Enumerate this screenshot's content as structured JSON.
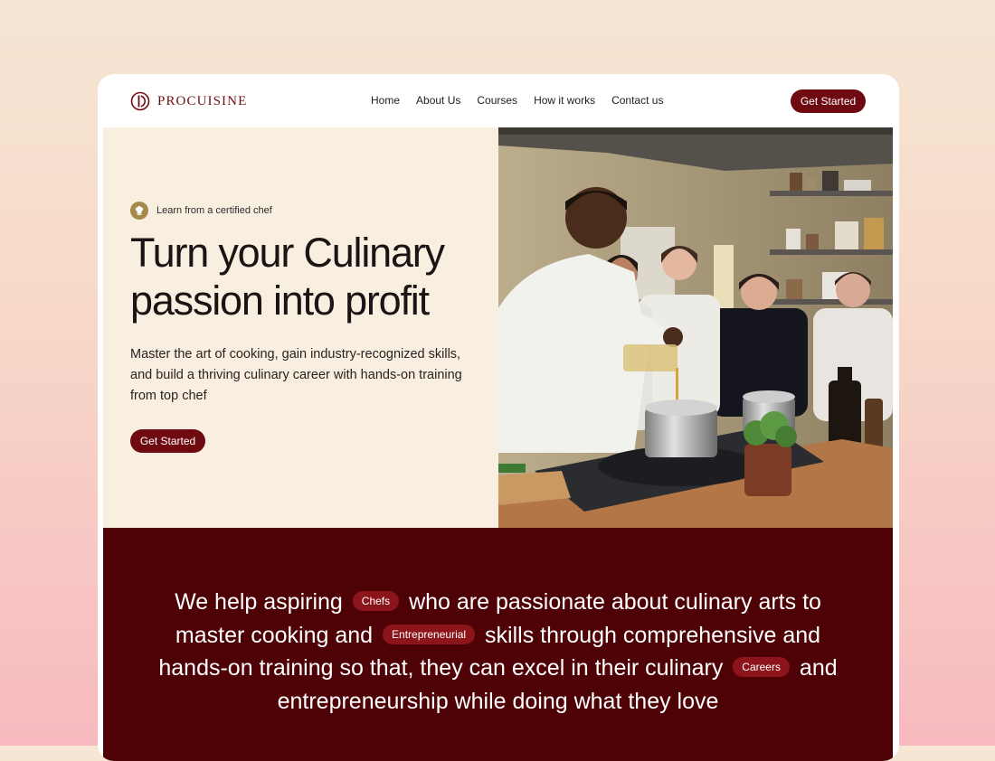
{
  "brand": {
    "name": "PROCUISINE",
    "color": "#6e0a10"
  },
  "nav": {
    "links": [
      "Home",
      "About Us",
      "Courses",
      "How it works",
      "Contact us"
    ],
    "cta_label": "Get Started"
  },
  "hero": {
    "badge_icon": "chef-hat-icon",
    "badge_text": "Learn from a certified chef",
    "title_line1": "Turn your Culinary",
    "title_line2": "passion into profit",
    "description": "Master the art of cooking, gain industry-recognized skills, and build a thriving culinary career with hands-on training from top chef",
    "cta_label": "Get Started",
    "image": "chefs-cooking-class-photo"
  },
  "mission": {
    "seg1": "We help aspiring",
    "tag1": "Chefs",
    "seg2": "who are passionate about culinary arts to master cooking and",
    "tag2": "Entrepreneurial",
    "seg3": "skills through comprehensive and hands-on training so that, they can excel in their culinary",
    "tag3": "Careers",
    "seg4": "and entrepreneurship while doing what they love",
    "background": "#4f0206",
    "tag_color": "#8c141b"
  }
}
